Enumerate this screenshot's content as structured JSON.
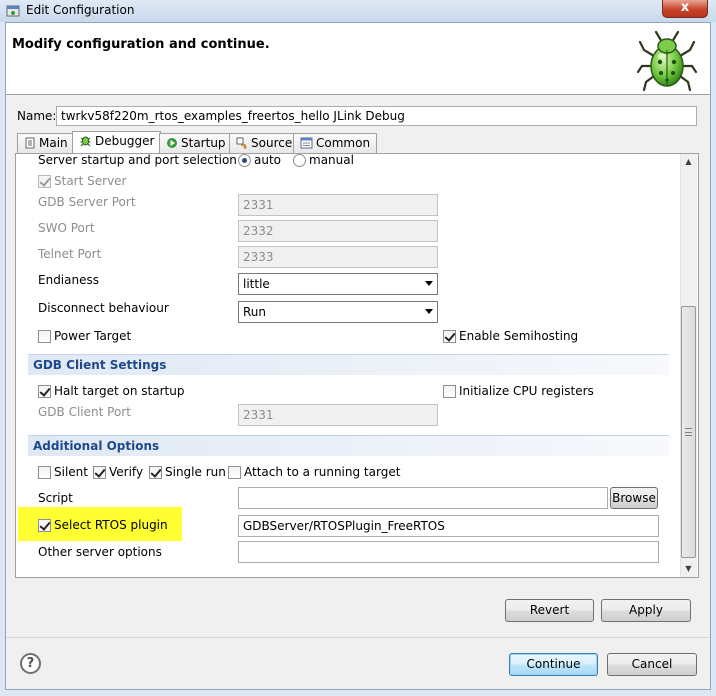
{
  "window": {
    "title": "Edit Configuration",
    "close_glyph": "x",
    "icon": "debug-configuration-icon"
  },
  "header": {
    "title": "Modify configuration and continue.",
    "icon": "bug-icon"
  },
  "name": {
    "label": "Name:",
    "value": "twrkv58f220m_rtos_examples_freertos_hello JLink Debug"
  },
  "tabs": [
    {
      "label": "Main",
      "icon": "main-tab-icon"
    },
    {
      "label": "Debugger",
      "icon": "debugger-bug-icon",
      "active": true
    },
    {
      "label": "Startup",
      "icon": "run-arrow-icon"
    },
    {
      "label": "Source",
      "icon": "source-icon"
    },
    {
      "label": "Common",
      "icon": "common-tab-icon"
    }
  ],
  "server": {
    "startup_label": "Server startup and port selection",
    "radio_auto": "auto",
    "radio_manual": "manual",
    "start_server": "Start Server",
    "gdb_port_label": "GDB Server Port",
    "gdb_port_value": "2331",
    "swo_port_label": "SWO Port",
    "swo_port_value": "2332",
    "telnet_port_label": "Telnet Port",
    "telnet_port_value": "2333",
    "endianess_label": "Endianess",
    "endianess_value": "little",
    "disconnect_label": "Disconnect behaviour",
    "disconnect_value": "Run",
    "power_target": "Power Target",
    "enable_semihosting": "Enable Semihosting"
  },
  "gdb_client": {
    "section_title": "GDB Client Settings",
    "halt_target": "Halt target on startup",
    "init_cpu": "Initialize CPU registers",
    "client_port_label": "GDB Client Port",
    "client_port_value": "2331"
  },
  "additional": {
    "section_title": "Additional Options",
    "silent": "Silent",
    "verify": "Verify",
    "single_run": "Single run",
    "attach": "Attach to a running target",
    "script_label": "Script",
    "script_value": "",
    "browse": "Browse",
    "rtos_label": "Select RTOS plugin",
    "rtos_value": "GDBServer/RTOSPlugin_FreeRTOS",
    "other_label": "Other server options",
    "other_value": ""
  },
  "buttons": {
    "revert": "Revert",
    "apply": "Apply",
    "continue": "Continue",
    "cancel": "Cancel",
    "help_glyph": "?"
  },
  "colors": {
    "highlight": "#ffff33",
    "section_text": "#1f4a8a"
  }
}
